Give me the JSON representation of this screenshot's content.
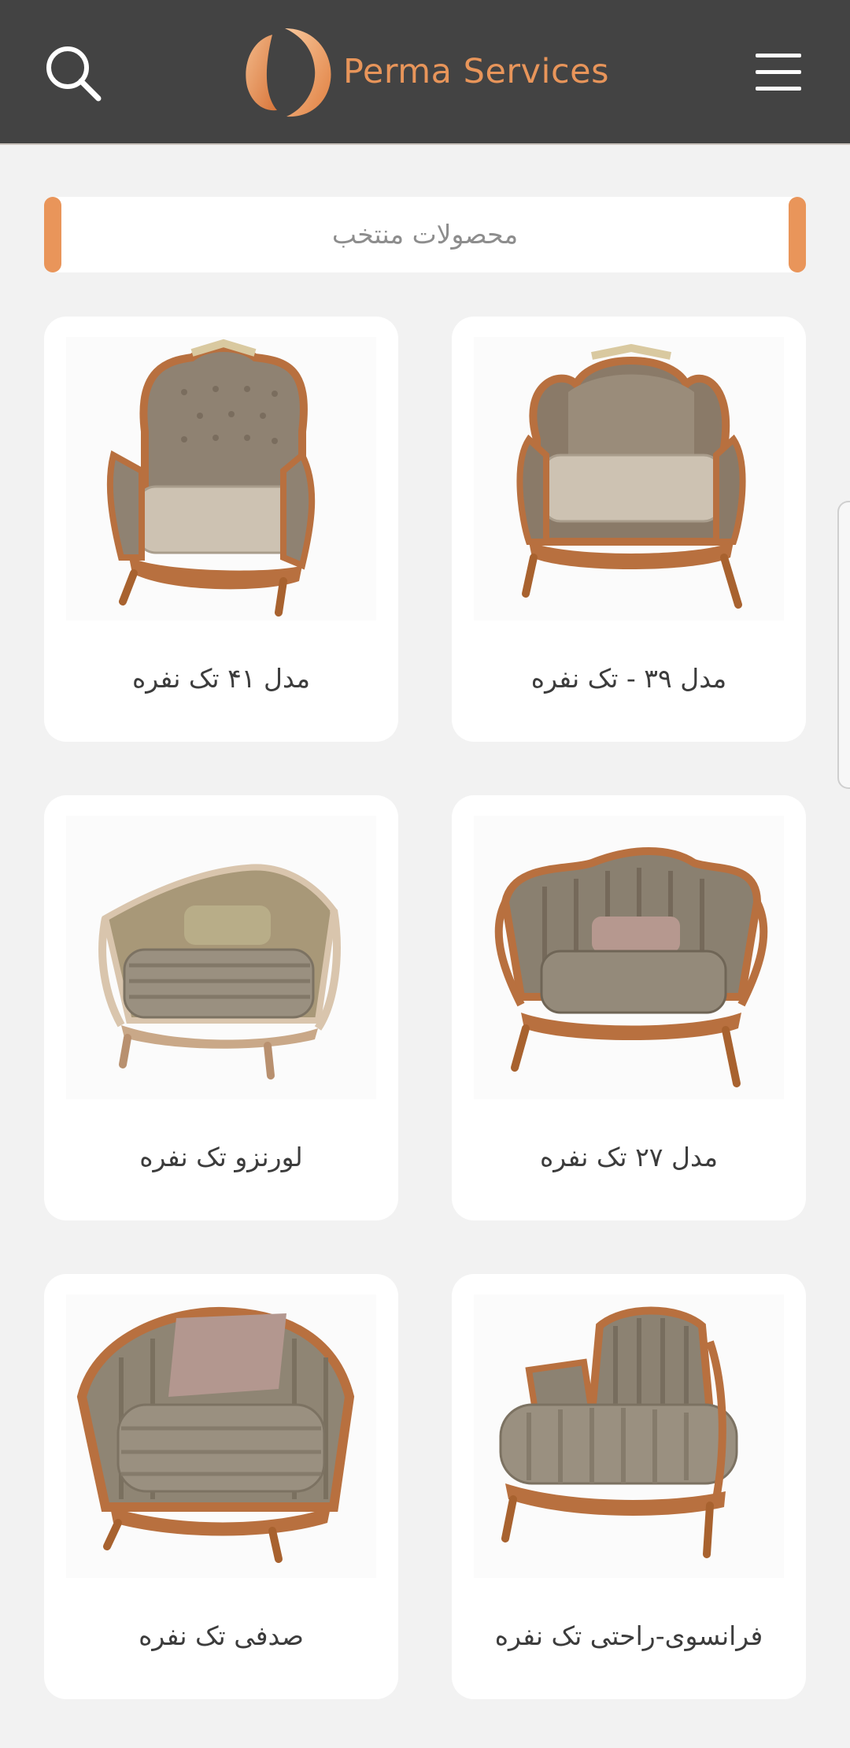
{
  "header": {
    "brand_name": "Perma Services",
    "search_icon": "search-icon",
    "menu_icon": "hamburger-menu-icon",
    "brand_color": "#e8955a",
    "background_color": "#434343"
  },
  "section": {
    "title": "محصولات منتخب"
  },
  "products": [
    {
      "title": "مدل ۳۹ - تک نفره",
      "image": "armchair-model-39"
    },
    {
      "title": "مدل ۴۱ تک نفره",
      "image": "armchair-model-41"
    },
    {
      "title": "مدل ۲۷ تک نفره",
      "image": "armchair-model-27"
    },
    {
      "title": "لورنزو تک نفره",
      "image": "armchair-lorenzo"
    },
    {
      "title": "فرانسوی-راحتی تک نفره",
      "image": "chaise-french"
    },
    {
      "title": "صدفی تک نفره",
      "image": "armchair-shell"
    }
  ]
}
